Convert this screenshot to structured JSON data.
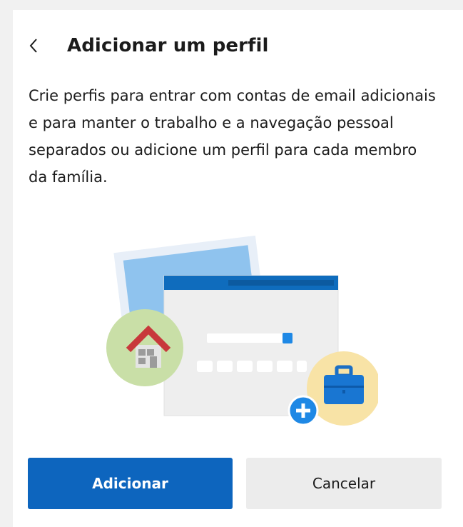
{
  "header": {
    "back_icon": "chevron-left-icon",
    "title": "Adicionar um perfil"
  },
  "description": "Crie perfis para entrar com contas de email adicionais e para manter o trabalho e a navegação pessoal separados ou adicione um perfil para cada membro da família.",
  "illustration": {
    "icons": [
      "browser-window-icon",
      "home-icon",
      "briefcase-icon",
      "plus-icon"
    ],
    "colors": {
      "accent_blue": "#0f6cbd",
      "light_blue": "#8fc3ee",
      "green_circle": "#c9dfa7",
      "yellow_circle": "#f8e3a6",
      "roof_red": "#c8383b",
      "briefcase_blue": "#1976d2"
    }
  },
  "buttons": {
    "primary_label": "Adicionar",
    "secondary_label": "Cancelar"
  },
  "colors": {
    "primary_button": "#0d65be",
    "secondary_button": "#ececec",
    "panel_background": "#ffffff",
    "page_background": "#f1f1f1"
  }
}
